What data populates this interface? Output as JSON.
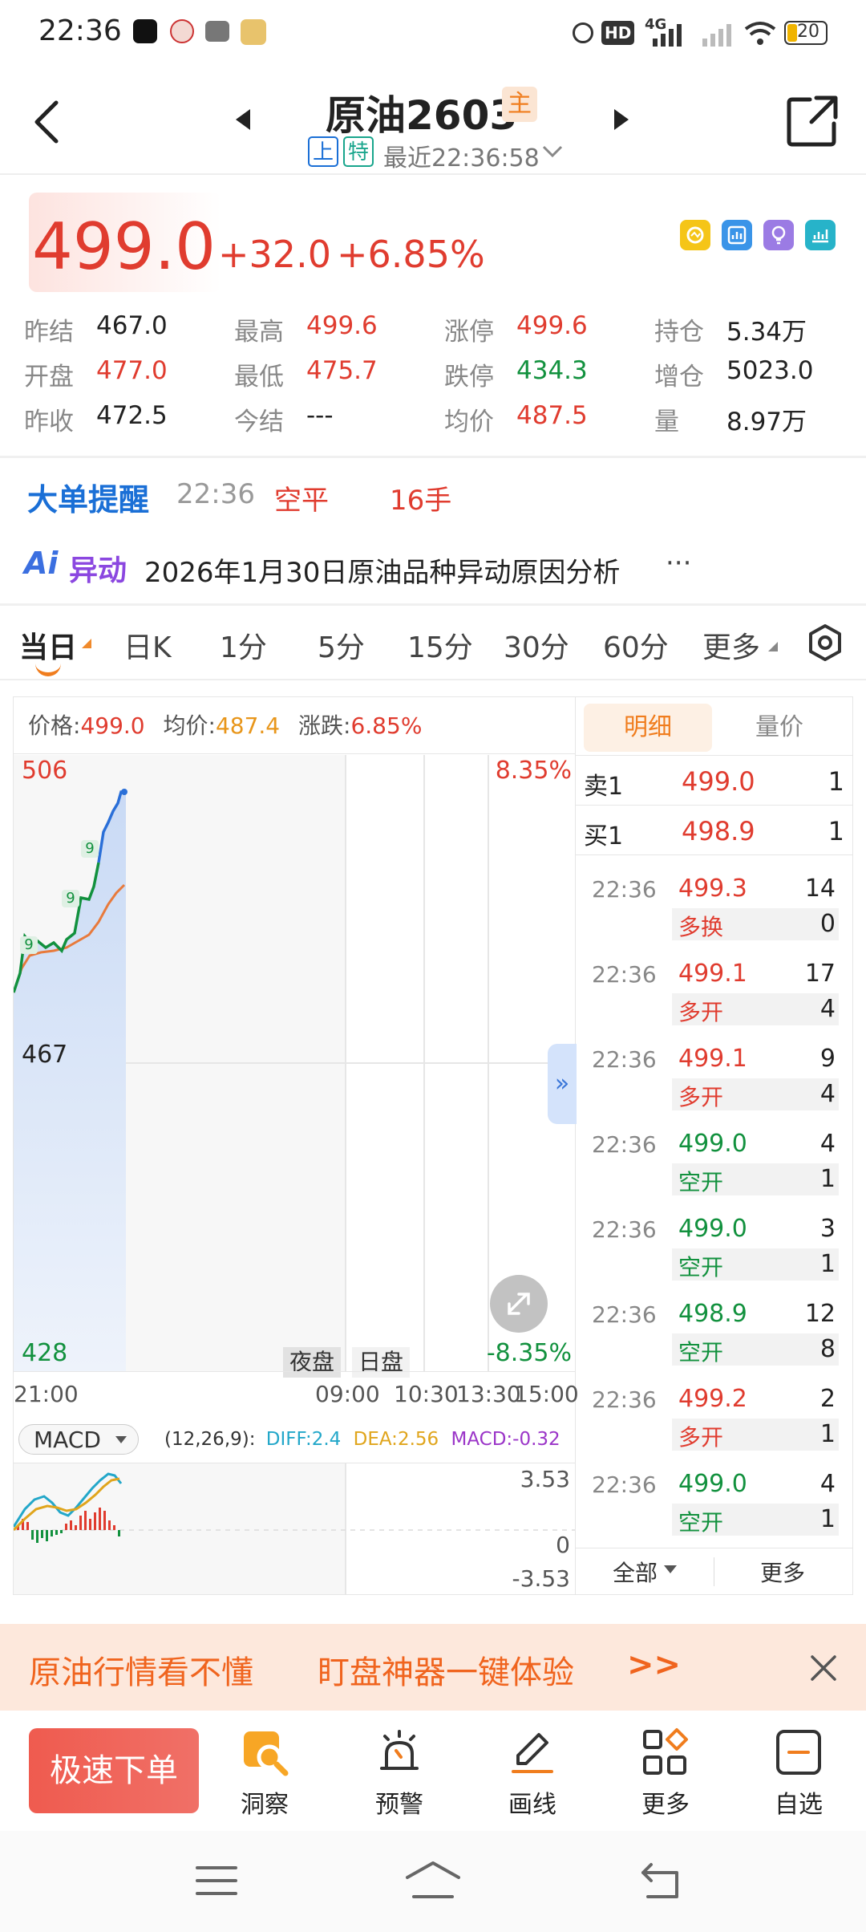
{
  "status_bar": {
    "time": "22:36",
    "hd_label": "HD",
    "signal_4g": "4G",
    "battery": "20"
  },
  "header": {
    "title": "原油2603",
    "main_badge": "主",
    "exchange_badge": "上",
    "special_badge": "特",
    "update_text": "最近22:36:58"
  },
  "quote": {
    "price": "499.0",
    "change": "+32.0",
    "change_pct": "+6.85%",
    "rows": [
      [
        {
          "label": "昨结",
          "value": "467.0",
          "color": "#222"
        },
        {
          "label": "最高",
          "value": "499.6",
          "color": "#e03c2f"
        },
        {
          "label": "涨停",
          "value": "499.6",
          "color": "#e03c2f"
        },
        {
          "label": "持仓",
          "value": "5.34万",
          "color": "#222"
        }
      ],
      [
        {
          "label": "开盘",
          "value": "477.0",
          "color": "#e03c2f"
        },
        {
          "label": "最低",
          "value": "475.7",
          "color": "#e03c2f"
        },
        {
          "label": "跌停",
          "value": "434.3",
          "color": "#12913e"
        },
        {
          "label": "增仓",
          "value": "5023.0",
          "color": "#222"
        }
      ],
      [
        {
          "label": "昨收",
          "value": "472.5",
          "color": "#222"
        },
        {
          "label": "今结",
          "value": "---",
          "color": "#222"
        },
        {
          "label": "均价",
          "value": "487.5",
          "color": "#e03c2f"
        },
        {
          "label": "量",
          "value": "8.97万",
          "color": "#222"
        }
      ]
    ]
  },
  "big_order": {
    "title": "大单提醒",
    "time": "22:36",
    "action": "空平",
    "qty": "16手"
  },
  "anomaly": {
    "logo_ai": "Ai",
    "logo_text": "异动",
    "text": "2026年1月30日原油品种异动原因分析",
    "more": "···"
  },
  "tabs": {
    "items": [
      "当日",
      "日K",
      "1分",
      "5分",
      "15分",
      "30分",
      "60分",
      "更多"
    ]
  },
  "chart_info": {
    "price_label": "价格:",
    "price": "499.0",
    "avg_label": "均价:",
    "avg": "487.4",
    "chg_label": "涨跌:",
    "chg": "6.85%",
    "y_top": "506",
    "y_mid": "467",
    "y_bottom": "428",
    "pct_top": "8.35%",
    "pct_bottom": "-8.35%",
    "night_label": "夜盘",
    "day_label": "日盘",
    "time_labels": [
      "21:00",
      "09:00",
      "10:30",
      "13:30",
      "15:00"
    ],
    "markers": [
      "9",
      "9",
      "9"
    ]
  },
  "macd": {
    "selector": "MACD",
    "params": "(12,26,9):",
    "diff_label": "DIFF:",
    "diff": "2.4",
    "dea_label": "DEA:",
    "dea": "2.56",
    "macd_label": "MACD:",
    "macd": "-0.32",
    "y_top": "3.53",
    "y_zero": "0",
    "y_bottom": "-3.53"
  },
  "order_book": {
    "tab_detail": "明细",
    "tab_volume_price": "量价",
    "sell1": {
      "label": "卖1",
      "price": "499.0",
      "vol": "1"
    },
    "buy1": {
      "label": "买1",
      "price": "498.9",
      "vol": "1"
    },
    "trades": [
      {
        "time": "22:36",
        "price": "499.3",
        "vol": "14",
        "type": "多换",
        "type_vol": "0",
        "color": "#e03c2f"
      },
      {
        "time": "22:36",
        "price": "499.1",
        "vol": "17",
        "type": "多开",
        "type_vol": "4",
        "color": "#e03c2f"
      },
      {
        "time": "22:36",
        "price": "499.1",
        "vol": "9",
        "type": "多开",
        "type_vol": "4",
        "color": "#e03c2f"
      },
      {
        "time": "22:36",
        "price": "499.0",
        "vol": "4",
        "type": "空开",
        "type_vol": "1",
        "color": "#12913e"
      },
      {
        "time": "22:36",
        "price": "499.0",
        "vol": "3",
        "type": "空开",
        "type_vol": "1",
        "color": "#12913e"
      },
      {
        "time": "22:36",
        "price": "498.9",
        "vol": "12",
        "type": "空开",
        "type_vol": "8",
        "color": "#12913e"
      },
      {
        "time": "22:36",
        "price": "499.2",
        "vol": "2",
        "type": "多开",
        "type_vol": "1",
        "color": "#e03c2f"
      },
      {
        "time": "22:36",
        "price": "499.0",
        "vol": "4",
        "type": "空开",
        "type_vol": "1",
        "color": "#12913e"
      }
    ],
    "filter_all": "全部",
    "more": "更多"
  },
  "promo": {
    "text1": "原油行情看不懂",
    "text2": "盯盘神器一键体验",
    "arrow": ">>"
  },
  "bottom_bar": {
    "order_button": "极速下单",
    "items": [
      {
        "label": "洞察",
        "icon": "insight-icon"
      },
      {
        "label": "预警",
        "icon": "alarm-icon"
      },
      {
        "label": "画线",
        "icon": "pen-icon"
      },
      {
        "label": "更多",
        "icon": "grid-icon"
      },
      {
        "label": "自选",
        "icon": "watchlist-icon"
      }
    ]
  },
  "colors": {
    "up": "#e03c2f",
    "down": "#12913e",
    "accent_blue": "#1a6fd6",
    "avg_orange": "#e8961b"
  }
}
